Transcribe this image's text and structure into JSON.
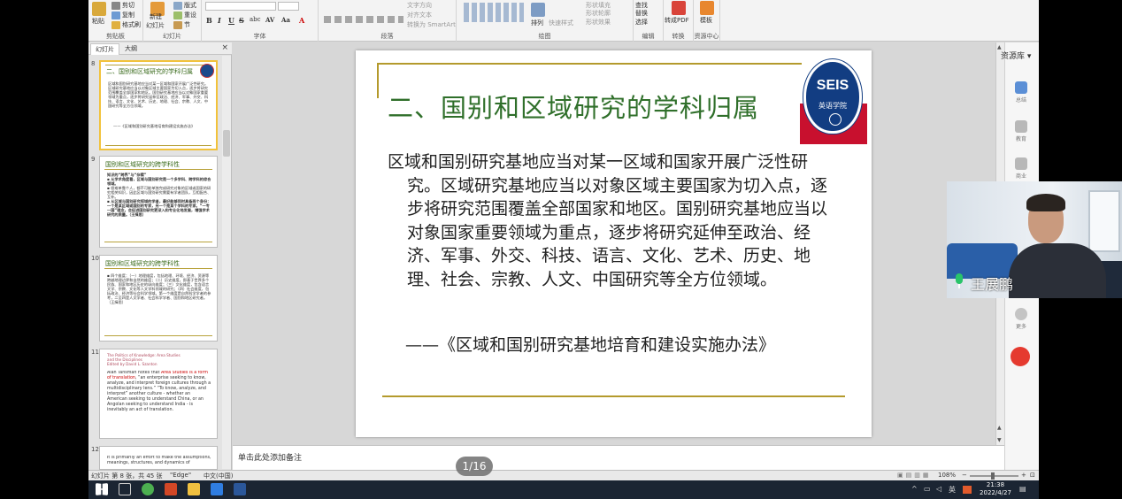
{
  "ribbon": {
    "clipboard": {
      "paste": "粘贴",
      "cut": "剪切",
      "copy": "复制",
      "format_painter": "格式刷",
      "label": "剪贴板"
    },
    "slides": {
      "new_slide": "新建",
      "new_slide2": "幻灯片",
      "layout": "版式",
      "reset": "重设",
      "section": "节",
      "label": "幻灯片"
    },
    "font": {
      "label": "字体",
      "bold": "B",
      "italic": "I",
      "underline": "U",
      "strike": "S",
      "shadow": "abc",
      "spacing": "AV",
      "aa": "Aa",
      "color": "A"
    },
    "paragraph": {
      "label": "段落",
      "text_dir": "文字方向",
      "align_text": "对齐文本",
      "smartart": "转换为 SmartArt"
    },
    "drawing": {
      "label": "绘图",
      "arrange": "排列",
      "quick_styles": "快速样式",
      "shape_fill": "形状填充",
      "shape_outline": "形状轮廓",
      "shape_effects": "形状效果"
    },
    "editing": {
      "label": "编辑",
      "find": "查找",
      "replace": "替换",
      "select": "选择"
    },
    "convert": {
      "label": "转换",
      "to_pdf": "转成PDF"
    },
    "resource": {
      "label": "资源中心",
      "template": "模板"
    }
  },
  "thumbpane": {
    "tabs": [
      "幻灯片",
      "大纲"
    ],
    "close": "×",
    "slides": [
      {
        "num": "8",
        "title": "二、国别和区域研究的学科归属",
        "body": "区域和国别研究基地应当对某一区域和国家开展广泛性研究。区域研究基地应当以对象区域主要国家为切入点，逐步将研究范围覆盖全部国家和地区。国别研究基地应当以对象国家重要领域为重点，逐步将研究延伸至政治、经济、军事、外交、科技、语言、文化、艺术、历史、地理、社会、宗教、人文、中国研究等全方位领域。",
        "quote": "——《区域和国别研究基地培育和建设实施办法》"
      },
      {
        "num": "9",
        "title": "国别和区域研究的跨学科性",
        "body1": "知识的“跨界”与“杂糅”",
        "body2": "▪ 从学术角度看，区域与国别研究是一个多学科、跨学科的综合领域。",
        "body3": "▪ 很难单靠个人，都不可能单独完成研究对象的区域或国家的研究相关知识，因此区域与国别研究需要有学者团队，互相配合、互补。",
        "body4": "▪ 从区域与国别研究视域的学者，最好能够同时具备两个身份：一个是某区域或国别的专家，另一个是某个学科的专家。“一专一国”理念，会促进国别研究更深入和专业化地发展，增强学术研究的质量。（王缉思）"
      },
      {
        "num": "10",
        "title": "国别和区域研究的跨学科性",
        "body": "▪ 四个维度：（一）地理维度，包括地理、环境、经济、资源等跨越地理边界和自然的维度；（二）历史维度，即基于世界多个民族、国家和地区历史的纵向维度；（三）文化维度，包含语言文学、宗教、文化等人文学科领域的研究；（四）社会维度，包括政治、经济等社会科学领域。第一个维度是自然科学学者的参考，二至四是人文学者、社会科学学者、国别和地区研究者。（王缉思）"
      },
      {
        "num": "11",
        "head1": "The Politics of Knowledge: Area Studies",
        "head2": "and the Disciplines",
        "head3": "Edited by David L. Szanton",
        "b1": "Alan Tansman notes that ",
        "b1red": "Area Studies is a form of translation",
        "b2": ", “an enterprise seeking to know, analyze, and interpret foreign cultures through a multidisciplinary lens.” “To know, analyze, and interpret” another culture - whether an American seeking to understand China, or an Angolan seeking to understand India - is inevitably an act of translation."
      },
      {
        "num": "12",
        "body": "It is primarily an effort to make the assumptions, meanings, structures, and dynamics of"
      }
    ]
  },
  "slide": {
    "title": "二、国别和区域研究的学科归属",
    "logo_text": "SEIS",
    "logo_cn": "英语学院",
    "body_first": "区域和国别研究基地应当对某一区域和国家开展广",
    "body_rest": "泛性研究。区域研究基地应当以对象区域主要国家为切入点，逐步将研究范围覆盖全部国家和地区。国别研究基地应当以对象国家重要领域为重点，逐步将研究延伸至政治、经济、军事、外交、科技、语言、文化、艺术、历史、地理、社会、宗教、人文、中国研究等全方位领域。",
    "quote": "——《区域和国别研究基地培育和建设实施办法》"
  },
  "notes": {
    "placeholder": "单击此处添加备注"
  },
  "pager": {
    "text": "1/16"
  },
  "statusbar": {
    "slide_info": "幻灯片 第 8 张，共 45 张",
    "theme": "\"Edge\"",
    "lang": "中文(中国)",
    "zoom": "108%"
  },
  "rsidebar": {
    "title": "资源库",
    "items": [
      "总结",
      "教育",
      "商业",
      "更多"
    ]
  },
  "taskbar": {
    "time": "21:38",
    "date": "2022/4/27"
  },
  "webcam": {
    "name": "王展鹏"
  },
  "colors": {
    "title_green": "#2f6f2a",
    "rule_gold": "#b49a2c",
    "logo_blue": "#123d82",
    "logo_red": "#c8102e",
    "selected_border": "#f2c23b"
  }
}
